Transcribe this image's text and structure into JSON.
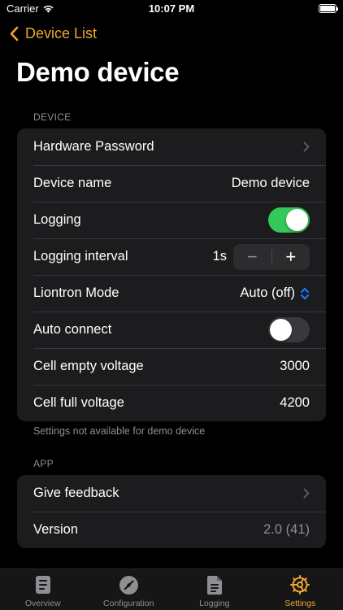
{
  "status_bar": {
    "carrier": "Carrier",
    "time": "10:07 PM"
  },
  "nav": {
    "back_label": "Device List",
    "title": "Demo device"
  },
  "device_section": {
    "header": "DEVICE",
    "footer": "Settings not available for demo device",
    "hardware_password": {
      "label": "Hardware Password"
    },
    "device_name": {
      "label": "Device name",
      "value": "Demo device"
    },
    "logging": {
      "label": "Logging",
      "enabled": true
    },
    "logging_interval": {
      "label": "Logging interval",
      "value": "1s",
      "minus": "−",
      "plus": "+"
    },
    "liontron_mode": {
      "label": "Liontron Mode",
      "value": "Auto (off)"
    },
    "auto_connect": {
      "label": "Auto connect",
      "enabled": false
    },
    "cell_empty_voltage": {
      "label": "Cell empty voltage",
      "value": "3000"
    },
    "cell_full_voltage": {
      "label": "Cell full voltage",
      "value": "4200"
    }
  },
  "app_section": {
    "header": "APP",
    "give_feedback": {
      "label": "Give feedback"
    },
    "version": {
      "label": "Version",
      "value": "2.0 (41)"
    }
  },
  "tab_bar": {
    "tabs": [
      {
        "label": "Overview",
        "icon": "document-icon",
        "active": false
      },
      {
        "label": "Configuration",
        "icon": "compass-icon",
        "active": false
      },
      {
        "label": "Logging",
        "icon": "log-file-icon",
        "active": false
      },
      {
        "label": "Settings",
        "icon": "gear-icon",
        "active": true
      }
    ]
  },
  "colors": {
    "accent": "#f0a32f",
    "toggle_on": "#34c759",
    "picker_arrows": "#0a84ff",
    "group_background": "#1c1c1e"
  }
}
